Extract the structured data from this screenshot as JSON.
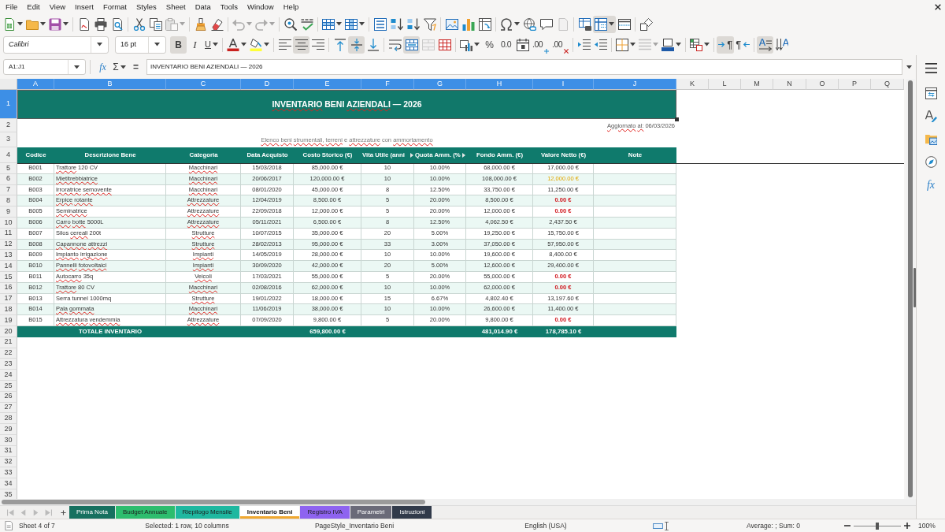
{
  "menu": {
    "items": [
      "File",
      "Edit",
      "View",
      "Insert",
      "Format",
      "Styles",
      "Sheet",
      "Data",
      "Tools",
      "Window",
      "Help"
    ]
  },
  "standard_toolbar": [
    [
      {
        "kind": "new",
        "menu": true,
        "on": false,
        "disabled": false
      },
      {
        "kind": "open",
        "menu": true,
        "on": false,
        "disabled": false
      },
      {
        "kind": "save",
        "menu": true,
        "on": false,
        "disabled": false
      }
    ],
    [
      {
        "kind": "export_pdf",
        "menu": false,
        "on": false,
        "disabled": false
      },
      {
        "kind": "print",
        "menu": false,
        "on": false,
        "disabled": false
      },
      {
        "kind": "preview",
        "menu": false,
        "on": false,
        "disabled": false
      }
    ],
    [
      {
        "kind": "cut",
        "menu": false,
        "on": false,
        "disabled": false
      },
      {
        "kind": "copy",
        "menu": false,
        "on": false,
        "disabled": false
      },
      {
        "kind": "paste",
        "menu": true,
        "on": false,
        "disabled": true
      }
    ],
    [
      {
        "kind": "clone",
        "menu": false,
        "on": false,
        "disabled": false
      },
      {
        "kind": "clear_format",
        "menu": false,
        "on": false,
        "disabled": false
      }
    ],
    [
      {
        "kind": "undo",
        "menu": true,
        "on": false,
        "disabled": true
      },
      {
        "kind": "redo",
        "menu": true,
        "on": false,
        "disabled": true
      }
    ],
    [
      {
        "kind": "find_replace",
        "menu": false,
        "on": false,
        "disabled": false
      },
      {
        "kind": "spelling",
        "menu": false,
        "on": false,
        "disabled": false
      }
    ],
    [
      {
        "kind": "row",
        "menu": true,
        "on": false,
        "disabled": false
      },
      {
        "kind": "column",
        "menu": true,
        "on": false,
        "disabled": false
      }
    ],
    [
      {
        "kind": "sort",
        "menu": false,
        "on": false,
        "disabled": false
      },
      {
        "kind": "sort_asc",
        "menu": false,
        "on": false,
        "disabled": false
      },
      {
        "kind": "sort_desc",
        "menu": false,
        "on": false,
        "disabled": false
      },
      {
        "kind": "autofilter",
        "menu": false,
        "on": false,
        "disabled": false
      }
    ],
    [
      {
        "kind": "image",
        "menu": false,
        "on": false,
        "disabled": false
      },
      {
        "kind": "chart",
        "menu": false,
        "on": false,
        "disabled": false
      },
      {
        "kind": "pivot",
        "menu": false,
        "on": false,
        "disabled": false
      }
    ],
    [
      {
        "kind": "special_char",
        "menu": true,
        "on": false,
        "disabled": false
      },
      {
        "kind": "hyperlink",
        "menu": false,
        "on": false,
        "disabled": false
      },
      {
        "kind": "comment",
        "menu": false,
        "on": false,
        "disabled": false
      },
      {
        "kind": "header_footer",
        "menu": false,
        "on": false,
        "disabled": true
      }
    ],
    [
      {
        "kind": "print_area",
        "menu": false,
        "on": false,
        "disabled": false
      },
      {
        "kind": "freeze",
        "menu": true,
        "on": true,
        "disabled": false
      },
      {
        "kind": "split",
        "menu": false,
        "on": false,
        "disabled": false
      }
    ],
    [
      {
        "kind": "draw",
        "menu": false,
        "on": false,
        "disabled": false
      }
    ]
  ],
  "formatting_toolbar": {
    "font_name": "Calibri",
    "font_size": "16 pt",
    "groups": [
      [
        {
          "kind": "bold",
          "label": "B",
          "menu": false,
          "on": true,
          "disabled": false
        },
        {
          "kind": "italic",
          "label": "I",
          "menu": false,
          "on": false,
          "disabled": false
        },
        {
          "kind": "underline",
          "label": "U",
          "menu": true,
          "on": false,
          "disabled": false
        }
      ],
      [
        {
          "kind": "font_color",
          "menu": true,
          "on": false,
          "disabled": false
        },
        {
          "kind": "highlight",
          "menu": true,
          "on": false,
          "disabled": false
        }
      ],
      [
        {
          "kind": "align_left",
          "menu": false,
          "on": false,
          "disabled": false
        },
        {
          "kind": "align_center",
          "menu": false,
          "on": true,
          "disabled": false
        },
        {
          "kind": "align_right",
          "menu": false,
          "on": false,
          "disabled": false
        }
      ],
      [
        {
          "kind": "align_top",
          "menu": false,
          "on": false,
          "disabled": false
        },
        {
          "kind": "align_middle",
          "menu": false,
          "on": true,
          "disabled": false
        },
        {
          "kind": "align_bottom",
          "menu": false,
          "on": false,
          "disabled": false
        }
      ],
      [
        {
          "kind": "wrap",
          "menu": false,
          "on": false,
          "disabled": false
        },
        {
          "kind": "merge_center",
          "menu": false,
          "on": true,
          "disabled": false
        },
        {
          "kind": "merge",
          "menu": false,
          "on": false,
          "disabled": true
        },
        {
          "kind": "unmerge",
          "menu": false,
          "on": false,
          "disabled": false
        }
      ],
      [
        {
          "kind": "number_format",
          "menu": true,
          "on": false,
          "disabled": false
        },
        {
          "kind": "percent",
          "label": "%",
          "menu": false,
          "on": false,
          "disabled": false
        },
        {
          "kind": "standard",
          "label": "0.0",
          "menu": false,
          "on": false,
          "disabled": false
        },
        {
          "kind": "date",
          "menu": false,
          "on": false,
          "disabled": false
        },
        {
          "kind": "add_decimal",
          "label": ".00",
          "menu": false,
          "on": false,
          "disabled": false
        },
        {
          "kind": "remove_decimal",
          "label": ".00",
          "menu": false,
          "on": false,
          "disabled": false
        }
      ],
      [
        {
          "kind": "indent_increase",
          "menu": false,
          "on": false,
          "disabled": false
        },
        {
          "kind": "indent_decrease",
          "menu": false,
          "on": false,
          "disabled": false
        }
      ],
      [
        {
          "kind": "borders",
          "menu": true,
          "on": false,
          "disabled": false
        },
        {
          "kind": "border_style",
          "menu": true,
          "on": false,
          "disabled": true
        },
        {
          "kind": "border_color",
          "menu": true,
          "on": false,
          "disabled": false
        }
      ],
      [
        {
          "kind": "conditional",
          "menu": true,
          "on": false,
          "disabled": false
        }
      ],
      [
        {
          "kind": "ltr",
          "label": "¶",
          "menu": false,
          "on": true,
          "disabled": false
        },
        {
          "kind": "rtl",
          "label": "¶",
          "menu": false,
          "on": false,
          "disabled": false
        }
      ],
      [
        {
          "kind": "text_horizontal",
          "menu": false,
          "on": true,
          "disabled": false
        },
        {
          "kind": "text_vertical",
          "menu": false,
          "on": false,
          "disabled": false
        }
      ]
    ]
  },
  "formula_bar": {
    "name_box": "A1:J1",
    "buttons": [
      {
        "kind": "function_wizard",
        "label": "fx",
        "menu": false
      },
      {
        "kind": "sum",
        "label": "Σ",
        "menu": true
      },
      {
        "kind": "formula",
        "label": "=",
        "menu": false
      }
    ],
    "formula": "INVENTARIO BENI AZIENDALI — 2026"
  },
  "sheet": {
    "columns": [
      {
        "label": "A",
        "selected": true
      },
      {
        "label": "B",
        "selected": true
      },
      {
        "label": "C",
        "selected": true
      },
      {
        "label": "D",
        "selected": true
      },
      {
        "label": "E",
        "selected": true
      },
      {
        "label": "F",
        "selected": true
      },
      {
        "label": "G",
        "selected": true
      },
      {
        "label": "H",
        "selected": true
      },
      {
        "label": "I",
        "selected": true
      },
      {
        "label": "J",
        "selected": true
      },
      {
        "label": "K",
        "selected": false
      },
      {
        "label": "L",
        "selected": false
      },
      {
        "label": "M",
        "selected": false
      },
      {
        "label": "N",
        "selected": false
      },
      {
        "label": "O",
        "selected": false
      },
      {
        "label": "P",
        "selected": false
      },
      {
        "label": "Q",
        "selected": false
      }
    ],
    "rows": [
      {
        "label": "1",
        "selected": true
      },
      {
        "label": "2",
        "selected": false
      },
      {
        "label": "3",
        "selected": false
      },
      {
        "label": "4",
        "selected": false
      },
      {
        "label": "5",
        "selected": false
      },
      {
        "label": "6",
        "selected": false
      },
      {
        "label": "7",
        "selected": false
      },
      {
        "label": "8",
        "selected": false
      },
      {
        "label": "9",
        "selected": false
      },
      {
        "label": "10",
        "selected": false
      },
      {
        "label": "11",
        "selected": false
      },
      {
        "label": "12",
        "selected": false
      },
      {
        "label": "13",
        "selected": false
      },
      {
        "label": "14",
        "selected": false
      },
      {
        "label": "15",
        "selected": false
      },
      {
        "label": "16",
        "selected": false
      },
      {
        "label": "17",
        "selected": false
      },
      {
        "label": "18",
        "selected": false
      },
      {
        "label": "19",
        "selected": false
      },
      {
        "label": "20",
        "selected": false
      },
      {
        "label": "21",
        "selected": false
      },
      {
        "label": "22",
        "selected": false
      },
      {
        "label": "23",
        "selected": false
      },
      {
        "label": "24",
        "selected": false
      },
      {
        "label": "25",
        "selected": false
      },
      {
        "label": "26",
        "selected": false
      },
      {
        "label": "27",
        "selected": false
      },
      {
        "label": "28",
        "selected": false
      },
      {
        "label": "29",
        "selected": false
      },
      {
        "label": "30",
        "selected": false
      },
      {
        "label": "31",
        "selected": false
      },
      {
        "label": "32",
        "selected": false
      },
      {
        "label": "33",
        "selected": false
      },
      {
        "label": "34",
        "selected": false
      },
      {
        "label": "35",
        "selected": false
      }
    ],
    "title": {
      "text": "INVENTARIO BENI AZIENDALI — 2026",
      "misspelled_words": [
        true,
        false,
        true,
        false,
        false
      ]
    },
    "updated": {
      "text": "Aggiornato al: 06/03/2026",
      "misspelled_words": [
        true,
        true,
        false
      ]
    },
    "subtitle": {
      "text": "Elenco beni strumentali, terreni e attrezzature con ammortamento",
      "misspelled_words": [
        true,
        true,
        true,
        true,
        false,
        true,
        false,
        true
      ]
    },
    "headers": [
      {
        "text": "Codice",
        "clipped": false
      },
      {
        "text": "Descrizione Bene",
        "clipped": false
      },
      {
        "text": "Categoria",
        "clipped": false
      },
      {
        "text": "Data Acquisto",
        "clipped": false
      },
      {
        "text": "Costo Storico (€)",
        "clipped": false
      },
      {
        "text": "Vita Utile (anni",
        "clipped": true
      },
      {
        "text": "Quota Amm. (%",
        "clipped": true
      },
      {
        "text": "Fondo Amm. (€)",
        "clipped": false
      },
      {
        "text": "Valore Netto (€)",
        "clipped": false
      },
      {
        "text": "Note",
        "clipped": false
      }
    ],
    "items": [
      {
        "code": "B001",
        "description": "Trattore 120 CV",
        "description_misspelled_words": [
          true,
          false,
          false
        ],
        "category": "Macchinari",
        "category_misspelled": true,
        "purchase_date": "15/03/2018",
        "cost": "85,000.00 €",
        "useful_life": "10",
        "rate": "10.00%",
        "accumulated": "68,000.00 €",
        "net_value": "17,000.00 €",
        "warning": false,
        "alert": false
      },
      {
        "code": "B002",
        "description": "Mietitrebbiatrice",
        "description_misspelled_words": [
          true
        ],
        "category": "Macchinari",
        "category_misspelled": true,
        "purchase_date": "20/06/2017",
        "cost": "120,000.00 €",
        "useful_life": "10",
        "rate": "10.00%",
        "accumulated": "108,000.00 €",
        "net_value": "12,000.00 €",
        "warning": true,
        "alert": false
      },
      {
        "code": "B003",
        "description": "Irroratrice semovente",
        "description_misspelled_words": [
          true,
          true
        ],
        "category": "Macchinari",
        "category_misspelled": true,
        "purchase_date": "08/01/2020",
        "cost": "45,000.00 €",
        "useful_life": "8",
        "rate": "12.50%",
        "accumulated": "33,750.00 €",
        "net_value": "11,250.00 €",
        "warning": false,
        "alert": false
      },
      {
        "code": "B004",
        "description": "Erpice rotante",
        "description_misspelled_words": [
          true,
          true
        ],
        "category": "Attrezzature",
        "category_misspelled": true,
        "purchase_date": "12/04/2019",
        "cost": "8,500.00 €",
        "useful_life": "5",
        "rate": "20.00%",
        "accumulated": "8,500.00 €",
        "net_value": "0.00 €",
        "warning": false,
        "alert": true
      },
      {
        "code": "B005",
        "description": "Seminatrice",
        "description_misspelled_words": [
          true
        ],
        "category": "Attrezzature",
        "category_misspelled": true,
        "purchase_date": "22/09/2018",
        "cost": "12,000.00 €",
        "useful_life": "5",
        "rate": "20.00%",
        "accumulated": "12,000.00 €",
        "net_value": "0.00 €",
        "warning": false,
        "alert": true
      },
      {
        "code": "B006",
        "description": "Carro botte 5000L",
        "description_misspelled_words": [
          true,
          true,
          false
        ],
        "category": "Attrezzature",
        "category_misspelled": true,
        "purchase_date": "05/11/2021",
        "cost": "6,500.00 €",
        "useful_life": "8",
        "rate": "12.50%",
        "accumulated": "4,062.50 €",
        "net_value": "2,437.50 €",
        "warning": false,
        "alert": false
      },
      {
        "code": "B007",
        "description": "Silos cereali 200t",
        "description_misspelled_words": [
          false,
          true,
          false
        ],
        "category": "Strutture",
        "category_misspelled": true,
        "purchase_date": "10/07/2015",
        "cost": "35,000.00 €",
        "useful_life": "20",
        "rate": "5.00%",
        "accumulated": "19,250.00 €",
        "net_value": "15,750.00 €",
        "warning": false,
        "alert": false
      },
      {
        "code": "B008",
        "description": "Capannone attrezzi",
        "description_misspelled_words": [
          true,
          true
        ],
        "category": "Strutture",
        "category_misspelled": true,
        "purchase_date": "28/02/2013",
        "cost": "95,000.00 €",
        "useful_life": "33",
        "rate": "3.00%",
        "accumulated": "37,050.00 €",
        "net_value": "57,950.00 €",
        "warning": false,
        "alert": false
      },
      {
        "code": "B009",
        "description": "Impianto irrigazione",
        "description_misspelled_words": [
          true,
          true
        ],
        "category": "Impianti",
        "category_misspelled": true,
        "purchase_date": "14/05/2019",
        "cost": "28,000.00 €",
        "useful_life": "10",
        "rate": "10.00%",
        "accumulated": "19,600.00 €",
        "net_value": "8,400.00 €",
        "warning": false,
        "alert": false
      },
      {
        "code": "B010",
        "description": "Pannelli fotovoltaici",
        "description_misspelled_words": [
          true,
          true
        ],
        "category": "Impianti",
        "category_misspelled": true,
        "purchase_date": "30/09/2020",
        "cost": "42,000.00 €",
        "useful_life": "20",
        "rate": "5.00%",
        "accumulated": "12,600.00 €",
        "net_value": "29,400.00 €",
        "warning": false,
        "alert": false
      },
      {
        "code": "B011",
        "description": "Autocarro 35q",
        "description_misspelled_words": [
          true,
          false
        ],
        "category": "Veicoli",
        "category_misspelled": true,
        "purchase_date": "17/03/2021",
        "cost": "55,000.00 €",
        "useful_life": "5",
        "rate": "20.00%",
        "accumulated": "55,000.00 €",
        "net_value": "0.00 €",
        "warning": false,
        "alert": true
      },
      {
        "code": "B012",
        "description": "Trattore 80 CV",
        "description_misspelled_words": [
          true,
          false,
          false
        ],
        "category": "Macchinari",
        "category_misspelled": true,
        "purchase_date": "02/08/2016",
        "cost": "62,000.00 €",
        "useful_life": "10",
        "rate": "10.00%",
        "accumulated": "62,000.00 €",
        "net_value": "0.00 €",
        "warning": false,
        "alert": true
      },
      {
        "code": "B013",
        "description": "Serra tunnel 1000mq",
        "description_misspelled_words": [
          false,
          false,
          false
        ],
        "category": "Strutture",
        "category_misspelled": true,
        "purchase_date": "19/01/2022",
        "cost": "18,000.00 €",
        "useful_life": "15",
        "rate": "6.67%",
        "accumulated": "4,802.40 €",
        "net_value": "13,197.60 €",
        "warning": false,
        "alert": false
      },
      {
        "code": "B014",
        "description": "Pala gommata",
        "description_misspelled_words": [
          true,
          true
        ],
        "category": "Macchinari",
        "category_misspelled": true,
        "purchase_date": "11/06/2019",
        "cost": "38,000.00 €",
        "useful_life": "10",
        "rate": "10.00%",
        "accumulated": "26,600.00 €",
        "net_value": "11,400.00 €",
        "warning": false,
        "alert": false
      },
      {
        "code": "B015",
        "description": "Attrezzatura vendemmia",
        "description_misspelled_words": [
          true,
          true
        ],
        "category": "Attrezzature",
        "category_misspelled": true,
        "purchase_date": "07/09/2020",
        "cost": "9,800.00 €",
        "useful_life": "5",
        "rate": "20.00%",
        "accumulated": "9,800.00 €",
        "net_value": "0.00 €",
        "warning": false,
        "alert": true
      }
    ],
    "total": {
      "label": "TOTALE INVENTARIO",
      "cost": "659,800.00 €",
      "accumulated": "481,014.90 €",
      "net_value": "178,785.10 €"
    }
  },
  "sheet_tabs": [
    {
      "label": "Prima Nota",
      "color": "#16705f",
      "selected": false
    },
    {
      "label": "Budget Annuale",
      "color": "#2dbd6e",
      "selected": false
    },
    {
      "label": "Riepilogo Mensile",
      "color": "#1fb8a0",
      "selected": false
    },
    {
      "label": "Inventario Beni",
      "color": "#f0a830",
      "selected": true
    },
    {
      "label": "Registro IVA",
      "color": "#8e63f0",
      "selected": false
    },
    {
      "label": "Parametri",
      "color": "#6a6a78",
      "selected": false
    },
    {
      "label": "Istruzioni",
      "color": "#313a4a",
      "selected": false
    }
  ],
  "sidebar": [
    {
      "kind": "menu"
    },
    {
      "kind": "properties"
    },
    {
      "kind": "styles"
    },
    {
      "kind": "gallery"
    },
    {
      "kind": "navigator"
    },
    {
      "kind": "functions",
      "label": "fx"
    }
  ],
  "status_bar": {
    "sheet": "Sheet 4 of 7",
    "selection": "Selected: 1 row, 10 columns",
    "page_style": "PageStyle_Inventario Beni",
    "language": "English (USA)",
    "summary": "Average: ; Sum: 0",
    "zoom_slider": {
      "level": 0.5
    },
    "zoom": "100%"
  }
}
